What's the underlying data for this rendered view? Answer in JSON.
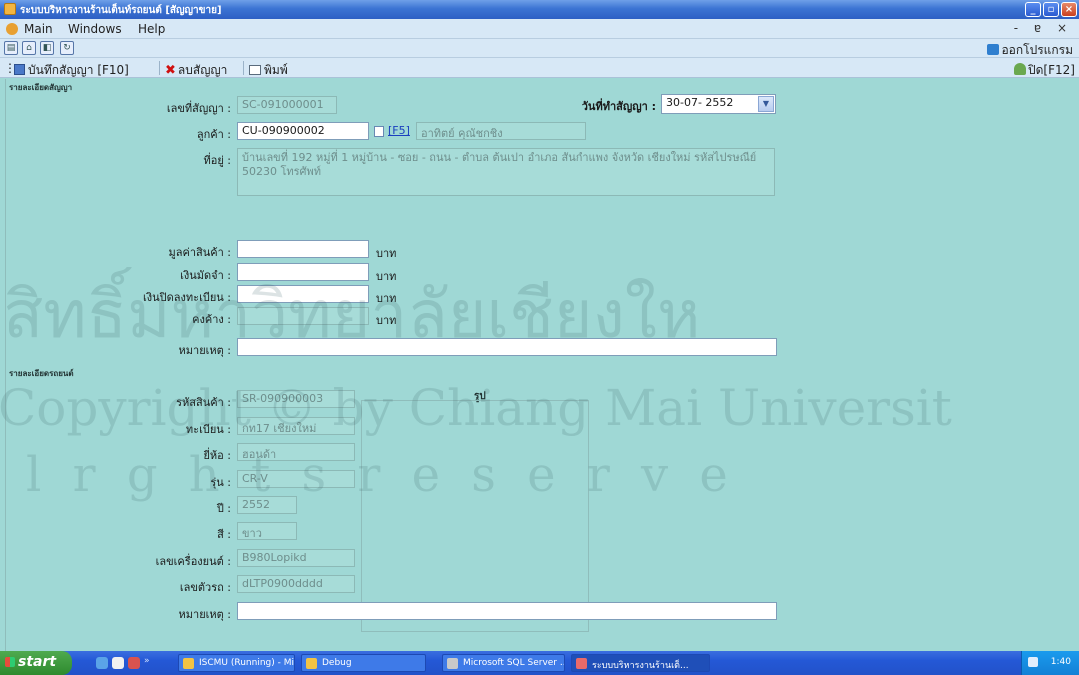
{
  "window": {
    "title": "ระบบบริหารงานร้านเต็นท์รถยนต์ [สัญญาขาย]"
  },
  "menu": {
    "items": [
      "Main",
      "Windows",
      "Help"
    ],
    "mdi_controls": "- ɐ ×"
  },
  "toolbar1": {
    "exit_label": "ออกโปรแกรม"
  },
  "toolbar2": {
    "save_label": "บันทึกสัญญา [F10]",
    "delete_label": "ลบสัญญา",
    "print_label": "พิมพ์",
    "close_label": "ปิด[F12]"
  },
  "contract": {
    "section_title": "รายละเอียดสัญญา",
    "contract_no_label": "เลขที่สัญญา :",
    "contract_no": "SC-091000001",
    "date_label": "วันที่ทำสัญญา :",
    "date_value": "30-07- 2552",
    "customer_label": "ลูกค้า :",
    "customer_code": "CU-090900002",
    "f5_label": "[F5]",
    "customer_name": "อาทิตย์ คุณัชกชิง",
    "address_label": "ที่อยู่ :",
    "address_value": "บ้านเลขที่ 192 หมู่ที่ 1 หมู่บ้าน - ซอย - ถนน - ตำบล ต้นเปา อำเภอ สันกำแพง จังหวัด เชียงใหม่ รหัสไปรษณีย์ 50230 โทรศัพท์",
    "price_label": "มูลค่าสินค้า :",
    "deposit_label": "เงินมัดจำ :",
    "transfer_label": "เงินปิดลงทะเบียน :",
    "balance_label": "คงค้าง :",
    "note_label": "หมายเหตุ :",
    "unit": "บาท"
  },
  "vehicle": {
    "section_title": "รายละเอียดรถยนต์",
    "product_code_label": "รหัสสินค้า :",
    "product_code": "SR-090900003",
    "plate_label": "ทะเบียน :",
    "plate": "กท17 เชียงใหม่",
    "brand_label": "ยี่ห้อ :",
    "brand": "ฮอนด้า",
    "model_label": "รุ่น :",
    "model": "CR-V",
    "year_label": "ปี :",
    "year": "2552",
    "color_label": "สี :",
    "color": "ขาว",
    "engine_label": "เลขเครื่องยนต์ :",
    "engine_no": "B980Lopikd",
    "chassis_label": "เลขตัวรถ :",
    "chassis_no": "dLTP0900dddd",
    "note_label": "หมายเหตุ :",
    "photo_label": "รูป"
  },
  "taskbar": {
    "start_label": "start",
    "tasks": [
      "ISCMU (Running) - Mi...",
      "Debug",
      "Microsoft SQL Server ...",
      "ระบบบริหารงานร้านเต็..."
    ],
    "clock": "1:40"
  },
  "watermark": {
    "line1": "สิทธิ์มหาวิทยาลัยเชียงให",
    "line2": "Copyright © by Chiang Mai Universit",
    "line3": "l r g h t s r e s e r v e"
  },
  "colors": {
    "form_bg": "#9fd8d5",
    "title_bar": "#3c74d3",
    "taskbar": "#2458d6"
  }
}
